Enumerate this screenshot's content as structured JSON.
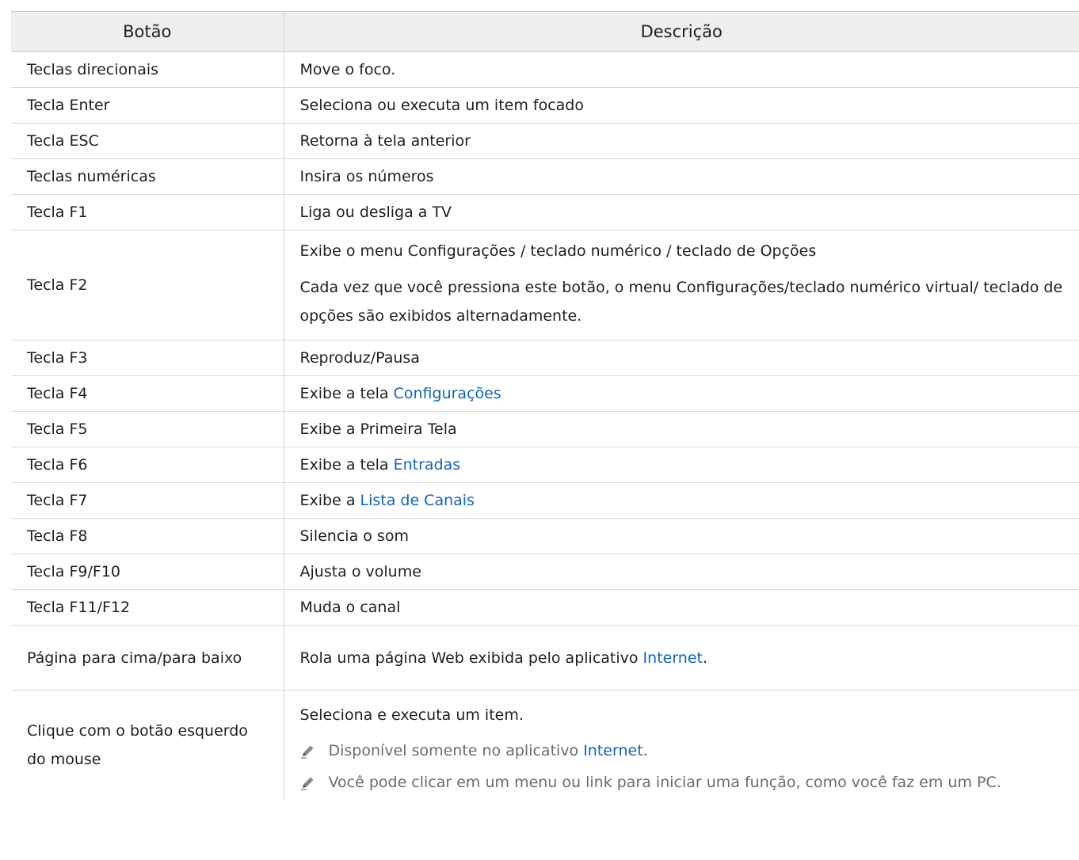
{
  "table": {
    "headers": [
      "Botão",
      "Descrição"
    ],
    "rows": [
      {
        "key": "Teclas direcionais",
        "desc": "Move o foco."
      },
      {
        "key": "Tecla Enter",
        "desc": "Seleciona ou executa um item focado"
      },
      {
        "key": "Tecla ESC",
        "desc": "Retorna à tela anterior"
      },
      {
        "key": "Teclas numéricas",
        "desc": "Insira os números"
      },
      {
        "key": "Tecla F1",
        "desc": "Liga ou desliga a TV"
      },
      {
        "key": "Tecla F2",
        "desc": "Exibe o menu Configurações / teclado numérico / teclado de Opções",
        "desc2": "Cada vez que você pressiona este botão, o menu Configurações/teclado numérico virtual/ teclado de opções são exibidos alternadamente."
      },
      {
        "key": "Tecla F3",
        "desc": "Reproduz/Pausa"
      },
      {
        "key": "Tecla F4",
        "desc_pre": "Exibe a tela ",
        "link": "Configurações"
      },
      {
        "key": "Tecla F5",
        "desc": "Exibe a Primeira Tela"
      },
      {
        "key": "Tecla F6",
        "desc_pre": "Exibe a tela ",
        "link": "Entradas"
      },
      {
        "key": "Tecla F7",
        "desc_pre": "Exibe a ",
        "link": "Lista de Canais"
      },
      {
        "key": "Tecla F8",
        "desc": "Silencia o som"
      },
      {
        "key": "Tecla F9/F10",
        "desc": "Ajusta o volume"
      },
      {
        "key": "Tecla F11/F12",
        "desc": "Muda o canal"
      },
      {
        "key": "Página para cima/para baixo",
        "desc_pre": "Rola uma página Web exibida pelo aplicativo ",
        "link": "Internet",
        "desc_post": "."
      },
      {
        "key": "Clique com o botão esquerdo do mouse",
        "desc": "Seleciona e executa um item.",
        "note1_pre": "Disponível somente no aplicativo ",
        "note1_link": "Internet",
        "note1_post": ".",
        "note2": "Você pode clicar em um menu ou link para iniciar uma função, como você faz em um PC."
      }
    ]
  },
  "colors": {
    "link": "#1464b4",
    "header_bg": "#eeeeee",
    "note": "#6b6b6b"
  },
  "icons": {
    "note": "pencil-note-icon"
  }
}
